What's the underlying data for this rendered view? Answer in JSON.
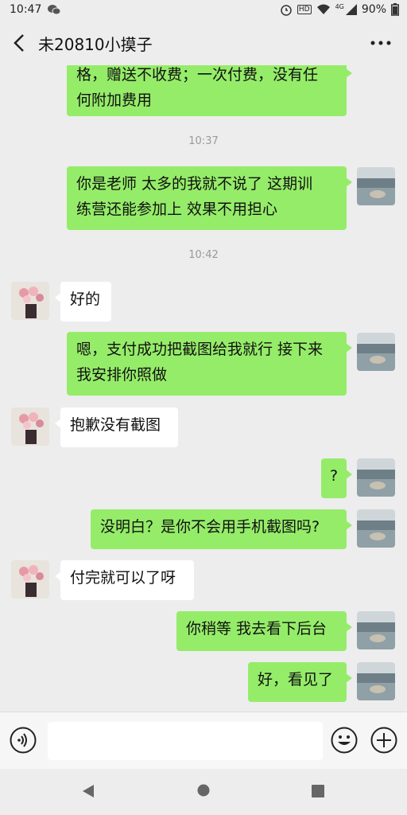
{
  "status_bar": {
    "time": "10:47",
    "battery": "90%",
    "network": "4G",
    "hd": "HD"
  },
  "header": {
    "title": "未20810小摸子"
  },
  "messages": [
    {
      "from": "me",
      "text_lines": [
        "格，赠送不收费；一次付费，没有任",
        "何附加费用"
      ]
    },
    {
      "type": "time",
      "text": "10:37"
    },
    {
      "from": "me",
      "text_lines": [
        "你是老师 太多的我就不说了 这期训",
        "练营还能参加上 效果不用担心"
      ]
    },
    {
      "type": "time",
      "text": "10:42"
    },
    {
      "from": "them",
      "text_lines": [
        "好的"
      ]
    },
    {
      "from": "me",
      "text_lines": [
        "嗯，支付成功把截图给我就行 接下来",
        "我安排你照做"
      ]
    },
    {
      "from": "them",
      "text_lines": [
        "抱歉没有截图"
      ]
    },
    {
      "from": "me",
      "text_lines": [
        "?"
      ]
    },
    {
      "from": "me",
      "text_lines": [
        "没明白？是你不会用手机截图吗?"
      ]
    },
    {
      "from": "them",
      "text_lines": [
        "付完就可以了呀"
      ]
    },
    {
      "from": "me",
      "text_lines": [
        "你稍等 我去看下后台"
      ]
    },
    {
      "from": "me",
      "text_lines": [
        "好，看见了"
      ]
    }
  ],
  "colors": {
    "my_bubble": "#95ec69",
    "their_bubble": "#ffffff",
    "background": "#ededed"
  },
  "icons": {
    "back": "chevron-left-icon",
    "more": "more-dots-icon",
    "voice": "voice-icon",
    "emoji": "emoji-icon",
    "plus": "plus-icon",
    "nav_back": "nav-back-icon",
    "nav_home": "nav-home-icon",
    "nav_recent": "nav-recent-icon"
  }
}
